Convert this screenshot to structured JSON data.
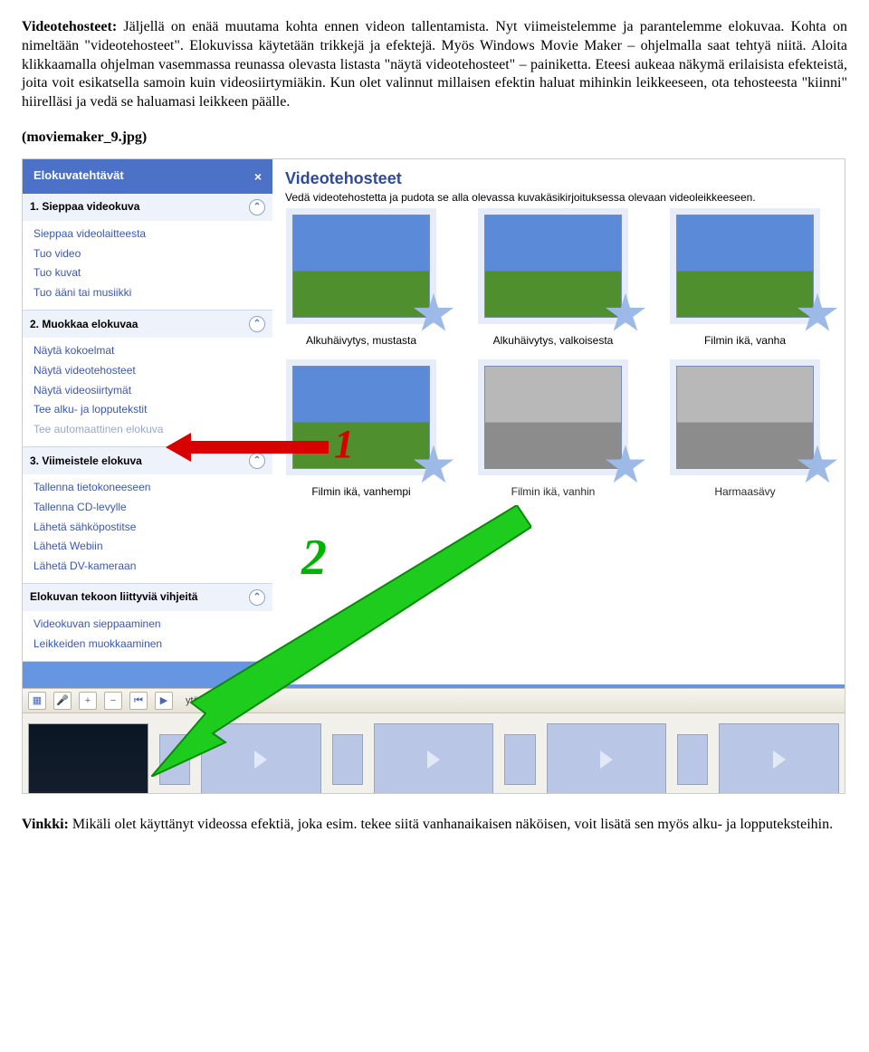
{
  "doc": {
    "p1_lead": "Videotehosteet:",
    "p1_body": " Jäljellä on enää muutama kohta ennen videon tallentamista. Nyt viimeistelemme ja parantelemme elokuvaa. Kohta on nimeltään \"videotehosteet\". Elokuvissa käytetään trikkejä ja efektejä. Myös Windows Movie Maker – ohjelmalla saat tehtyä niitä. Aloita klikkaamalla ohjelman vasemmassa reunassa olevasta listasta \"näytä videotehosteet\" – painiketta. Eteesi aukeaa näkymä erilaisista efekteistä, joita voit esikatsella samoin kuin videosiirtymiäkin. Kun olet valinnut millaisen efektin haluat mihinkin leikkeeseen, ota tehosteesta \"kiinni\" hiirelläsi ja vedä se haluamasi leikkeen päälle.",
    "caption": "(moviemaker_9.jpg)",
    "tip_lead": "Vinkki:",
    "tip_body": " Mikäli olet käyttänyt videossa efektiä, joka esim. tekee siitä vanhanaikaisen näköisen, voit lisätä sen myös alku- ja lopputeksteihin."
  },
  "sidebar": {
    "title": "Elokuvatehtävät",
    "groups": [
      {
        "head": "1. Sieppaa videokuva",
        "items": [
          "Sieppaa videolaitteesta",
          "Tuo video",
          "Tuo kuvat",
          "Tuo ääni tai musiikki"
        ]
      },
      {
        "head": "2. Muokkaa elokuvaa",
        "items": [
          "Näytä kokoelmat",
          "Näytä videotehosteet",
          "Näytä videosiirtymät",
          "Tee alku- ja lopputekstit",
          "Tee automaattinen elokuva"
        ],
        "disabled_index": 4
      },
      {
        "head": "3. Viimeistele elokuva",
        "items": [
          "Tallenna tietokoneeseen",
          "Tallenna CD-levylle",
          "Lähetä sähköpostitse",
          "Lähetä Webiin",
          "Lähetä DV-kameraan"
        ]
      },
      {
        "head": "Elokuvan tekoon liittyviä vihjeitä",
        "items": [
          "Videokuvan sieppaaminen",
          "Leikkeiden muokkaaminen"
        ]
      }
    ]
  },
  "main": {
    "title": "Videotehosteet",
    "subtitle": "Vedä videotehostetta ja pudota se alla olevassa kuvakäsikirjoituksessa olevaan videoleikkeeseen.",
    "effects": [
      "Alkuhäivytys, mustasta",
      "Alkuhäivytys, valkoisesta",
      "Filmin ikä, vanha",
      "Filmin ikä, vanhempi",
      "Filmin ikä, vanhin",
      "Harmaasävy"
    ]
  },
  "toolbar": {
    "label": "ytä aikajana"
  },
  "annotations": {
    "n1": "1",
    "n2": "2"
  }
}
